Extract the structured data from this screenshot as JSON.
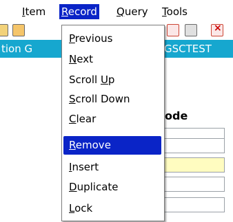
{
  "menubar": {
    "items": [
      {
        "label": "Item",
        "mnemonic": "I"
      },
      {
        "label": "Record",
        "mnemonic": "R",
        "active": true
      },
      {
        "label": "Query",
        "mnemonic": "Q"
      },
      {
        "label": "Tools",
        "mnemonic": "T"
      }
    ]
  },
  "titlebar": {
    "left_text": "tion G",
    "right_text": "GSCTEST"
  },
  "form": {
    "column_label": "ode"
  },
  "record_menu": {
    "items": [
      {
        "label": "Previous",
        "mnemonic_index": 0
      },
      {
        "label": "Next",
        "mnemonic_index": 0
      },
      {
        "label": "Scroll Up",
        "mnemonic_index": 7
      },
      {
        "label": "Scroll Down",
        "mnemonic_index": 0
      },
      {
        "label": "Clear",
        "mnemonic_index": 0
      },
      {
        "label": "Remove",
        "mnemonic_index": 0,
        "selected": true
      },
      {
        "label": "Insert",
        "mnemonic_index": 0
      },
      {
        "label": "Duplicate",
        "mnemonic_index": 0
      },
      {
        "label": "Lock",
        "mnemonic_index": 0
      }
    ]
  },
  "colors": {
    "highlight": "#0a24c7",
    "titlebar_bg": "#16a7cf",
    "current_field_bg": "#fffcc0"
  }
}
